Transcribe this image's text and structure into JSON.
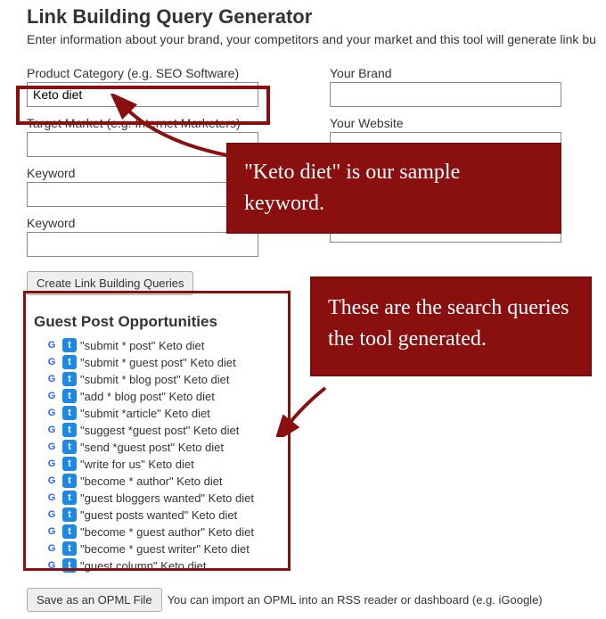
{
  "page": {
    "title": "Link Building Query Generator",
    "subtitle": "Enter information about your brand, your competitors and your market and this tool will generate link bu"
  },
  "form": {
    "product_category": {
      "label": "Product Category (e.g. SEO Software)",
      "value": "Keto diet"
    },
    "your_brand": {
      "label": "Your Brand",
      "value": ""
    },
    "target_market": {
      "label": "Target Market (e.g. Internet Marketers)",
      "value": ""
    },
    "your_website": {
      "label": "Your Website",
      "value": ""
    },
    "keyword1": {
      "label": "Keyword",
      "value": ""
    },
    "keyword2_right": {
      "label": "",
      "value": ""
    },
    "keyword2": {
      "label": "Keyword",
      "value": ""
    },
    "keyword3_right": {
      "label": "",
      "value": ""
    },
    "submit_label": "Create Link Building Queries"
  },
  "results": {
    "heading": "Guest Post Opportunities",
    "items": [
      "\"submit * post\" Keto diet",
      "\"submit * guest post\" Keto diet",
      "\"submit * blog post\" Keto diet",
      "\"add * blog post\" Keto diet",
      "\"submit *article\" Keto diet",
      "\"suggest *guest post\" Keto diet",
      "\"send *guest post\" Keto diet",
      "\"write for us\" Keto diet",
      "\"become * author\" Keto diet",
      "\"guest bloggers wanted\" Keto diet",
      "\"guest posts wanted\" Keto diet",
      "\"become * guest author\" Keto diet",
      "\"become * guest writer\" Keto diet",
      "\"guest column\" Keto diet"
    ]
  },
  "opml": {
    "button_label": "Save as an OPML File",
    "note": "You can import an OPML into an RSS reader or dashboard (e.g. iGoogle)"
  },
  "annotations": {
    "callout1": "\"Keto diet\" is our sample keyword.",
    "callout2": "These are the search queries the tool generated."
  },
  "colors": {
    "annotation_red": "#8a0f0f"
  }
}
